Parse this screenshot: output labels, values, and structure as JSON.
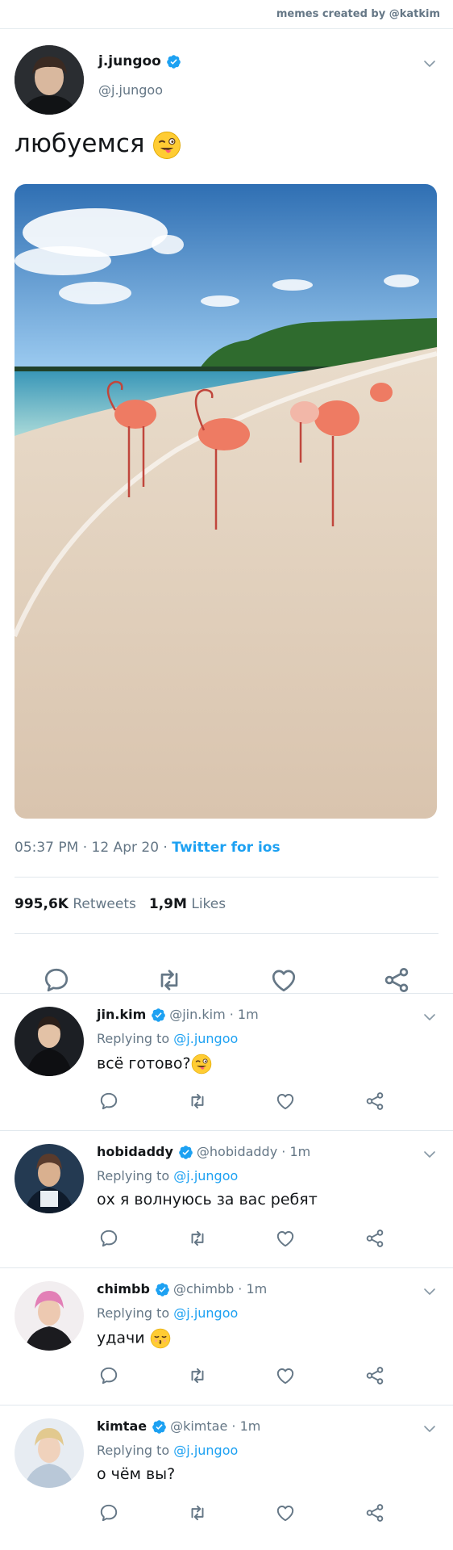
{
  "credit": "memes created by @katkim",
  "tweet": {
    "name": "j.jungoo",
    "handle": "@j.jungoo",
    "text": "любуемся",
    "time": "05:37 PM · 12 Apr 20 ·",
    "source": "Twitter for ios",
    "retweets_count": "995,6K",
    "retweets_label": "Retweets",
    "likes_count": "1,9M",
    "likes_label": "Likes"
  },
  "replying_label": "Replying to",
  "replies": [
    {
      "name": "jin.kim",
      "handle": "@jin.kim · 1m",
      "mention": "@j.jungoo",
      "text": "всё готово?"
    },
    {
      "name": "hobidaddy",
      "handle": "@hobidaddy · 1m",
      "mention": "@j.jungoo",
      "text": "ох я волнуюсь за вас ребят"
    },
    {
      "name": "chimbb",
      "handle": "@chimbb · 1m",
      "mention": "@j.jungoo",
      "text": "удачи"
    },
    {
      "name": "kimtae",
      "handle": "@kimtae · 1m",
      "mention": "@j.jungoo",
      "text": "о чём вы?"
    }
  ],
  "colors": {
    "accent": "#1da1f2",
    "muted": "#657786",
    "text": "#14171a",
    "divider": "#e1e8ed"
  },
  "icons": [
    "verified-badge-icon",
    "chevron-down-icon",
    "reply-icon",
    "retweet-icon",
    "like-icon",
    "share-icon",
    "winking-tongue-emoji",
    "kissing-emoji"
  ]
}
